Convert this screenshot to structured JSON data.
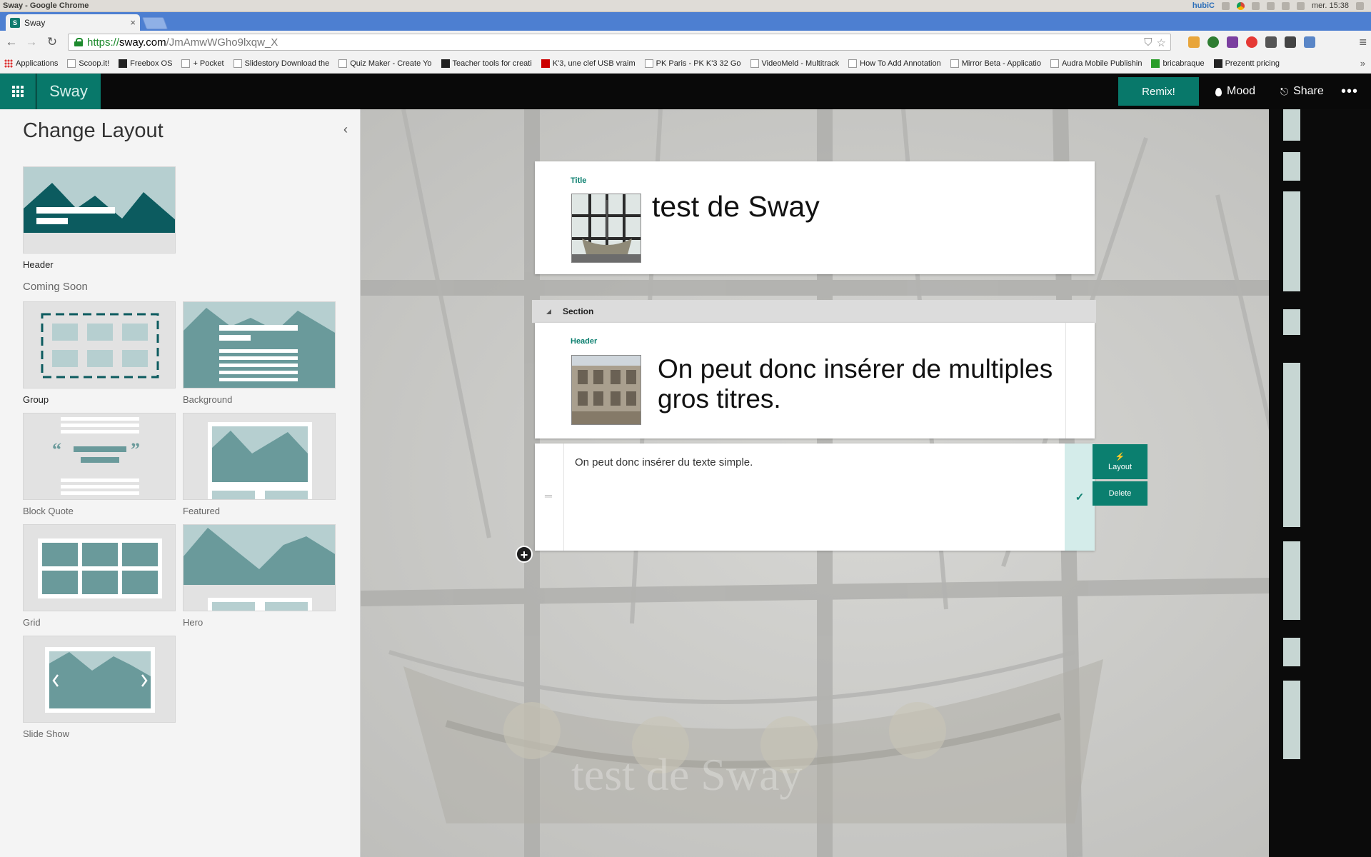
{
  "os": {
    "window_title": "Sway - Google Chrome",
    "tray_label": "hubiC",
    "clock": "mer. 15:38"
  },
  "browser": {
    "tab_title": "Sway",
    "tab_favicon_label": "S",
    "url_scheme": "https://",
    "url_host": "sway.com",
    "url_path": "/JmAmwWGho9lxqw_X",
    "bookmarks": [
      "Applications",
      "Scoop.it!",
      "Freebox OS",
      "+ Pocket",
      "Slidestory Download the",
      "Quiz Maker - Create Yo",
      "Teacher tools for creati",
      "K'3, une clef USB vraim",
      "PK Paris - PK K'3 32 Go",
      "VideoMeld - Multitrack",
      "How To Add Annotation",
      "Mirror Beta - Applicatio",
      "Audra Mobile Publishin",
      "bricabraque",
      "Prezentt pricing"
    ]
  },
  "app": {
    "name": "Sway",
    "remix_label": "Remix!",
    "mood_label": "Mood",
    "share_label": "Share",
    "more_label": "•••",
    "brand_color": "#08786a"
  },
  "panel": {
    "title": "Change Layout",
    "coming_soon": "Coming Soon",
    "layouts": {
      "header": "Header",
      "group": "Group",
      "background": "Background",
      "block_quote": "Block Quote",
      "featured": "Featured",
      "grid": "Grid",
      "hero": "Hero",
      "slide_show": "Slide Show"
    }
  },
  "canvas": {
    "title_card": {
      "tag": "Title",
      "heading": "test de Sway"
    },
    "section_label": "Section",
    "header_card": {
      "tag": "Header",
      "heading": "On peut donc insérer de multiples gros titres."
    },
    "text_card": {
      "body": "On peut donc insérer du texte simple."
    },
    "layout_button": "Layout",
    "delete_button": "Delete",
    "ghost_title": "test de Sway"
  }
}
